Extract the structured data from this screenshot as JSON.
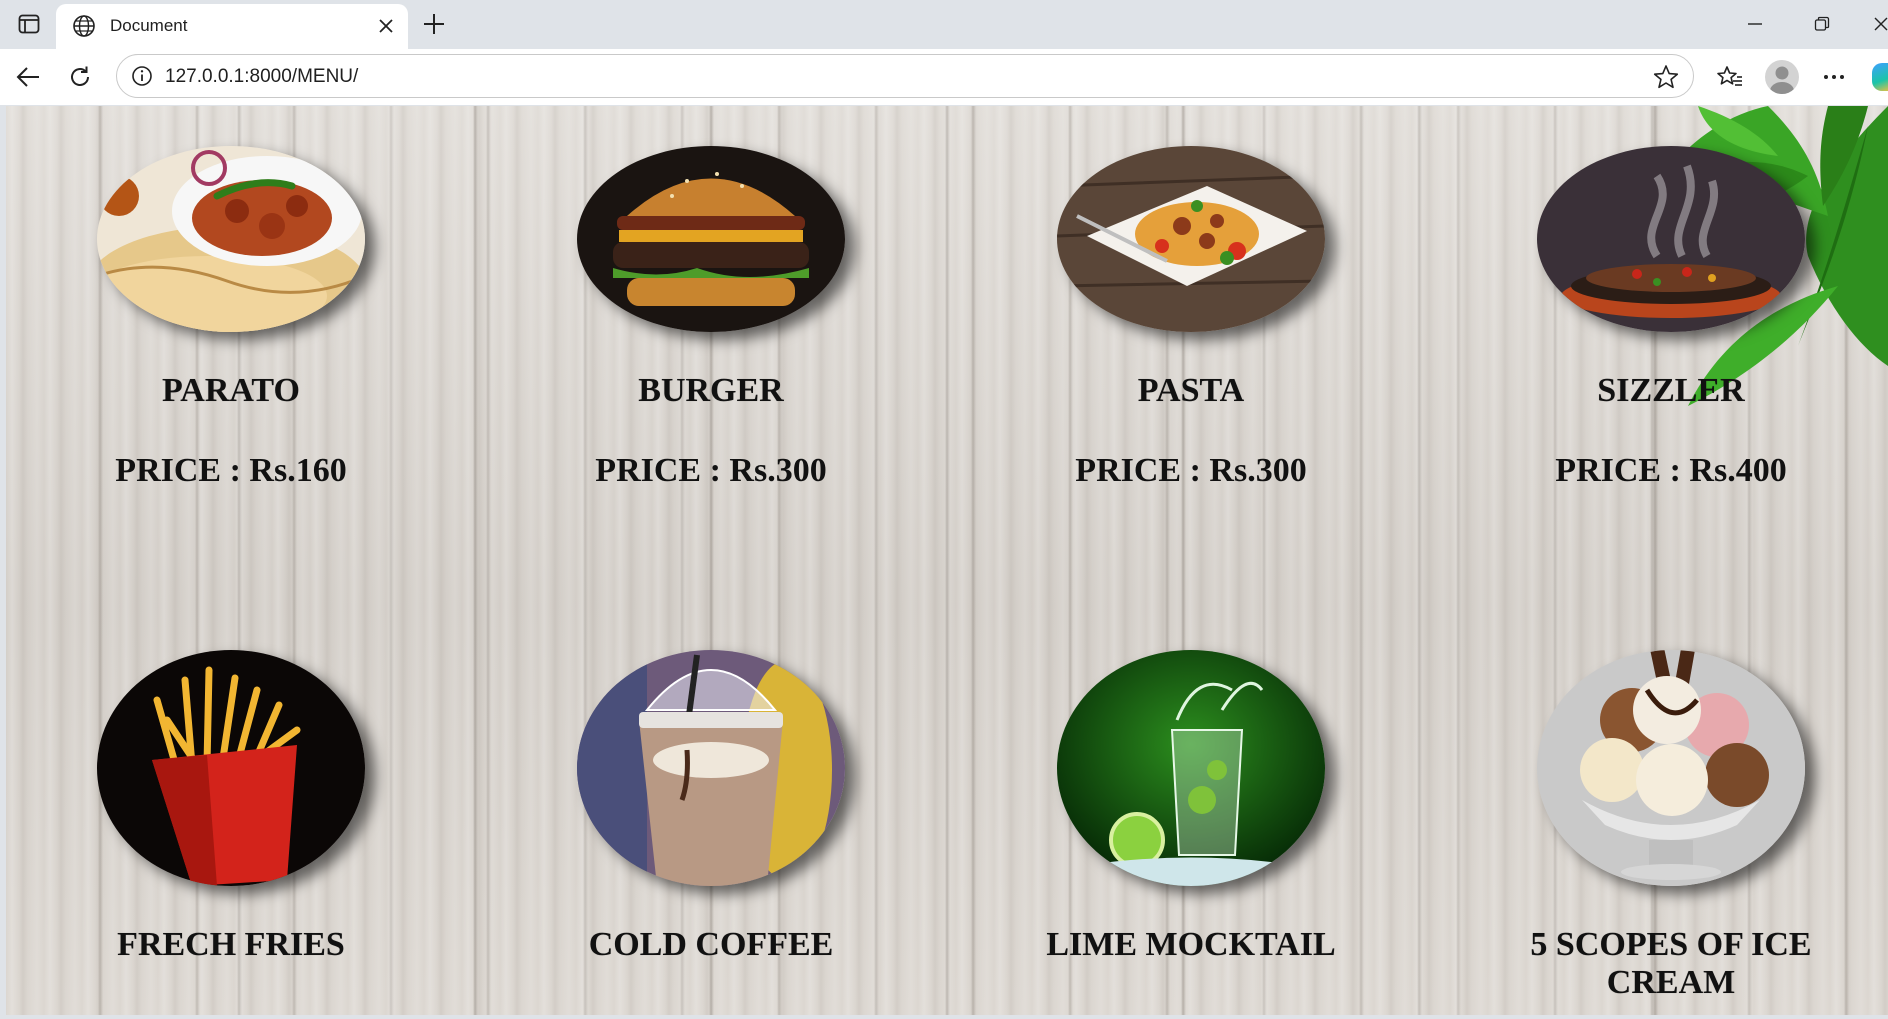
{
  "browser": {
    "tab_title": "Document",
    "url": "127.0.0.1:8000/MENU/"
  },
  "icons": {
    "tab_actions": "tab-actions-icon",
    "favicon": "globe-icon",
    "close": "close-icon",
    "new_tab": "plus-icon",
    "minimize": "minimize-icon",
    "restore": "restore-icon",
    "back": "back-arrow-icon",
    "reload": "reload-icon",
    "site_info": "info-icon",
    "favorite": "star-icon",
    "favorites": "favorites-icon",
    "profile": "avatar-icon",
    "more": "more-icon"
  },
  "menu": {
    "items": [
      {
        "name": "PARATO",
        "price": "PRICE : Rs.160"
      },
      {
        "name": "BURGER",
        "price": "PRICE : Rs.300"
      },
      {
        "name": "PASTA",
        "price": "PRICE : Rs.300"
      },
      {
        "name": "SIZZLER",
        "price": "PRICE : Rs.400"
      },
      {
        "name": "FRECH FRIES"
      },
      {
        "name": "COLD COFFEE"
      },
      {
        "name": "LIME MOCKTAIL"
      },
      {
        "name": "5 SCOPES OF ICE CREAM"
      }
    ]
  }
}
